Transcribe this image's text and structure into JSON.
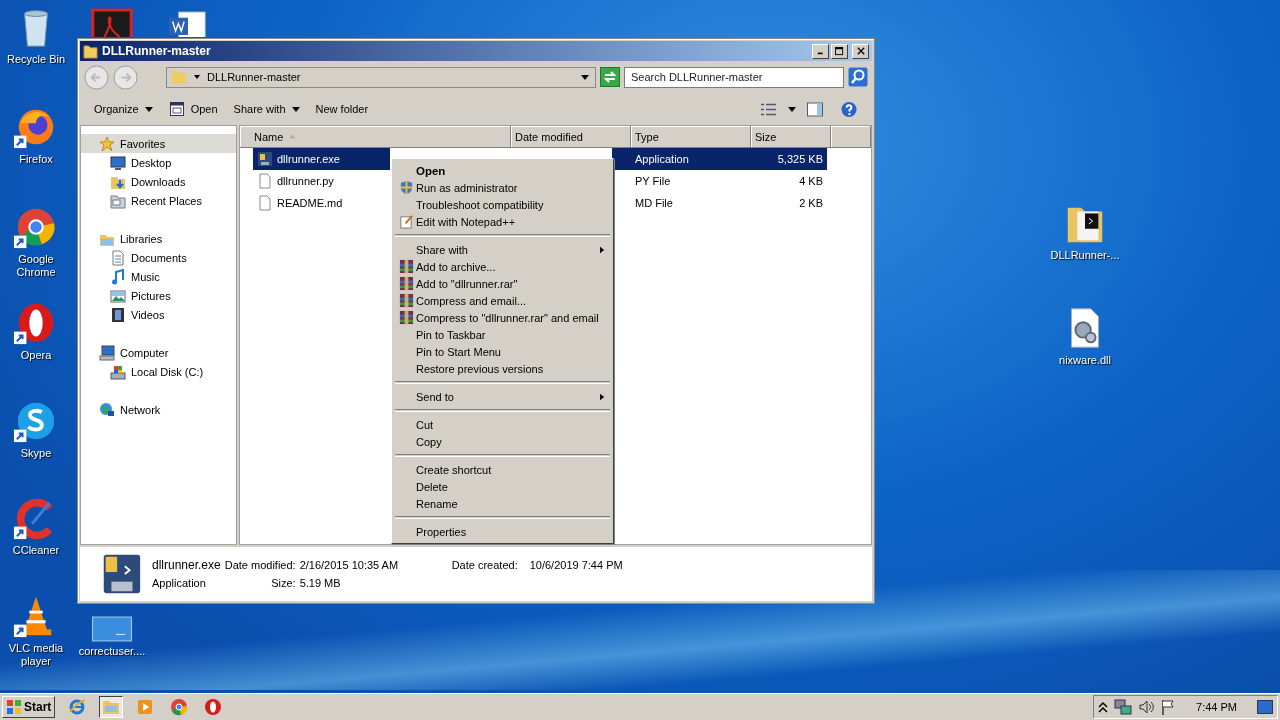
{
  "desktop_icons": [
    {
      "kind": "recycle-bin",
      "label": "Recycle Bin"
    },
    {
      "kind": "firefox",
      "label": "Firefox"
    },
    {
      "kind": "chrome",
      "label": "Google Chrome"
    },
    {
      "kind": "opera",
      "label": "Opera"
    },
    {
      "kind": "skype",
      "label": "Skype"
    },
    {
      "kind": "ccleaner",
      "label": "CCleaner"
    },
    {
      "kind": "vlc",
      "label": "VLC media player"
    },
    {
      "kind": "blank",
      "label": "correctuser...."
    },
    {
      "kind": "acrobat"
    },
    {
      "kind": "word"
    },
    {
      "kind": "folder",
      "label": "DLLRunner-..."
    },
    {
      "kind": "dll",
      "label": "nixware.dll"
    }
  ],
  "window": {
    "title": "DLLRunner-master",
    "address": "DLLRunner-master",
    "search": {
      "placeholder": "Search DLLRunner-master"
    },
    "toolbar": [
      {
        "label": "Organize",
        "kind": "dropdown"
      },
      {
        "label": "Open",
        "kind": "icon"
      },
      {
        "label": "Share with",
        "kind": "dropdown"
      },
      {
        "label": "New folder",
        "kind": "plain"
      }
    ],
    "navigation": [
      {
        "label": "Favorites",
        "kind": "star",
        "highlighted": true,
        "children": [
          {
            "label": "Desktop",
            "kind": "desktop",
            "highlighted": false
          },
          {
            "label": "Downloads",
            "kind": "downloads",
            "highlighted": false
          },
          {
            "label": "Recent Places",
            "kind": "recent",
            "highlighted": false
          }
        ]
      },
      {
        "label": "Libraries",
        "kind": "libraries",
        "highlighted": false,
        "children": [
          {
            "label": "Documents",
            "kind": "documents",
            "highlighted": false
          },
          {
            "label": "Music",
            "kind": "music",
            "highlighted": false
          },
          {
            "label": "Pictures",
            "kind": "pictures",
            "highlighted": false
          },
          {
            "label": "Videos",
            "kind": "videos",
            "highlighted": false
          }
        ]
      },
      {
        "label": "Computer",
        "kind": "computer",
        "highlighted": false,
        "children": [
          {
            "label": "Local Disk (C:)",
            "kind": "disk",
            "highlighted": false
          }
        ]
      },
      {
        "label": "Network",
        "kind": "network",
        "highlighted": false
      }
    ],
    "table": {
      "columns": [
        "Name",
        "Date modified",
        "Type",
        "Size"
      ],
      "rows": [
        {
          "name": "dllrunner.exe",
          "kind": "exe",
          "type": "Application",
          "size": "5,325 KB",
          "selected": true
        },
        {
          "name": "dllrunner.py",
          "kind": "file",
          "type": "PY File",
          "size": "4 KB",
          "selected": false
        },
        {
          "name": "README.md",
          "kind": "file",
          "type": "MD File",
          "size": "2 KB",
          "selected": false
        }
      ]
    },
    "details": {
      "name": "dllrunner.exe",
      "type": "Application",
      "fields": [
        {
          "label": "Date modified:",
          "value": "2/16/2015 10:35 AM"
        },
        {
          "label": "Size:",
          "value": "5.19 MB"
        },
        {
          "label": "Date created:",
          "value": "10/6/2019 7:44 PM"
        }
      ]
    }
  },
  "context_menu": {
    "items": [
      {
        "kind": "item",
        "label": "Open",
        "default": true,
        "submenu": false
      },
      {
        "kind": "shield",
        "label": "Run as administrator",
        "default": false,
        "submenu": false
      },
      {
        "kind": "item",
        "label": "Troubleshoot compatibility",
        "default": false,
        "submenu": false
      },
      {
        "kind": "notepad",
        "label": "Edit with Notepad++",
        "default": false,
        "submenu": false
      },
      {
        "kind": "separator"
      },
      {
        "kind": "item",
        "label": "Share with",
        "default": false,
        "submenu": true
      },
      {
        "kind": "archive",
        "label": "Add to archive...",
        "default": false,
        "submenu": false
      },
      {
        "kind": "archive",
        "label": "Add to \"dllrunner.rar\"",
        "default": false,
        "submenu": false
      },
      {
        "kind": "archive",
        "label": "Compress and email...",
        "default": false,
        "submenu": false
      },
      {
        "kind": "archive",
        "label": "Compress to \"dllrunner.rar\" and email",
        "default": false,
        "submenu": false
      },
      {
        "kind": "item",
        "label": "Pin to Taskbar",
        "default": false,
        "submenu": false
      },
      {
        "kind": "item",
        "label": "Pin to Start Menu",
        "default": false,
        "submenu": false
      },
      {
        "kind": "item",
        "label": "Restore previous versions",
        "default": false,
        "submenu": false
      },
      {
        "kind": "separator"
      },
      {
        "kind": "item",
        "label": "Send to",
        "default": false,
        "submenu": true
      },
      {
        "kind": "separator"
      },
      {
        "kind": "item",
        "label": "Cut",
        "default": false,
        "submenu": false
      },
      {
        "kind": "item",
        "label": "Copy",
        "default": false,
        "submenu": false
      },
      {
        "kind": "separator"
      },
      {
        "kind": "item",
        "label": "Create shortcut",
        "default": false,
        "submenu": false
      },
      {
        "kind": "item",
        "label": "Delete",
        "default": false,
        "submenu": false
      },
      {
        "kind": "item",
        "label": "Rename",
        "default": false,
        "submenu": false
      },
      {
        "kind": "separator"
      },
      {
        "kind": "item",
        "label": "Properties",
        "default": false,
        "submenu": false
      }
    ]
  },
  "taskbar": {
    "start": "Start",
    "apps": [
      {
        "kind": "ie",
        "selected": false
      },
      {
        "kind": "explorer",
        "selected": true
      },
      {
        "kind": "media",
        "selected": false
      },
      {
        "kind": "chrome",
        "selected": false
      },
      {
        "kind": "opera",
        "selected": false
      }
    ],
    "clock": "7:44 PM"
  }
}
